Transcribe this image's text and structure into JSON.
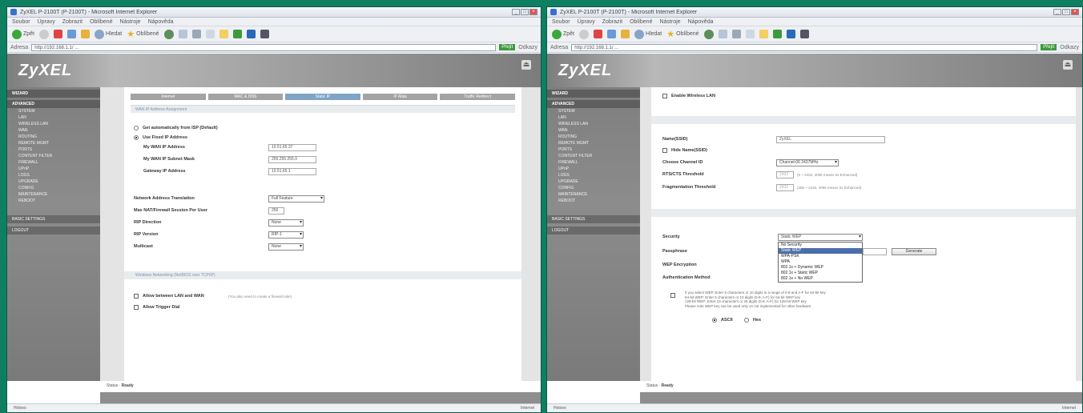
{
  "browser": {
    "title": "ZyXEL P-2100T (P-2100T) - Microsoft Internet Explorer",
    "menu": [
      "Soubor",
      "Úpravy",
      "Zobrazit",
      "Oblíbené",
      "Nástroje",
      "Nápověda"
    ],
    "back_label": "Zpět",
    "search_label": "Hledat",
    "favorites_label": "Oblíbené",
    "address_label": "Adresa",
    "address": "http://192.168.1.1/ ...",
    "go_label": "Přejít",
    "links_label": "Odkazy",
    "status_left": "Hotovo",
    "status_right": "Internet"
  },
  "left": {
    "logo": "ZyXEL",
    "nav_group_1": "WIZARD",
    "nav_group_2": "ADVANCED",
    "nav_items": [
      "SYSTEM",
      "LAN",
      "WIRELESS LAN",
      "WAN",
      "ROUTING",
      "REMOTE MGMT",
      "PORTS",
      "CONTENT FILTER",
      "FIREWALL",
      "UPnP",
      "LOGS",
      "UPGRADE",
      "CONFIG",
      "MAINTENANCE",
      "REBOOT"
    ],
    "nav_sub_1": "BASIC SETTINGS",
    "nav_sub_2": "LOGOUT",
    "tabs": [
      "Internet",
      "MAC & DNS",
      "Static IP",
      "IP Alias",
      "Traffic Redirect"
    ],
    "section_title": "WAN IP Address Assignment",
    "radio_auto": "Get automatically from ISP (Default)",
    "radio_fixed": "Use Fixed IP Address",
    "fields": [
      {
        "label": "My WAN IP Address",
        "value": "10.51.65.37"
      },
      {
        "label": "My WAN IP Subnet Mask",
        "value": "255.255.255.0"
      },
      {
        "label": "Gateway IP Address",
        "value": "10.51.65.1"
      }
    ],
    "nat_label": "Network Address Translation",
    "nat_value": "Full Feature",
    "mss_label": "Max NAT/Firewall Session Per User",
    "mss_value": "256",
    "rip_dir_label": "RIP Direction",
    "rip_dir_value": "None",
    "rip_ver_label": "RIP Version",
    "rip_ver_value": "RIP-1",
    "multicast_label": "Multicast",
    "multicast_value": "None",
    "section2_title": "Windows Networking (NetBIOS over TCP/IP)",
    "cb1": "Allow between LAN and WAN",
    "cb1_note": "(You also need to create a firewall rule!)",
    "cb2": "Allow Trigger Dial",
    "footer_status": "Status",
    "footer_ready": "Ready"
  },
  "right": {
    "logo": "ZyXEL",
    "enable_wlan": "Enable Wireless LAN",
    "ssid_label": "Name(SSID)",
    "ssid_value": "ZyXEL",
    "hide_ssid": "Hide Name(SSID)",
    "channel_label": "Choose Channel ID",
    "channel_value": "Channel-06 2437MHz",
    "rts_label": "RTS/CTS Threshold",
    "rts_value": "2432",
    "rts_note": "(0 ~ 2432, 4096 means 0x Enhanced)",
    "frag_label": "Fragmentation Threshold",
    "frag_value": "2432",
    "frag_note": "(256 ~ 2432, 4096 means 0x Enhanced)",
    "security_label": "Security",
    "security_value": "Static WEP",
    "security_options": [
      "No Security",
      "Static WEP",
      "WPA-PSK",
      "WPA",
      "802.1x + Dynamic WEP",
      "802.1x + Static WEP",
      "802.1x + No WEP"
    ],
    "passphrase_label": "Passphrase",
    "generate_label": "Generate",
    "wep_label": "WEP Encryption",
    "auth_label": "Authentication Method",
    "wiz_notes": [
      "If you select WEP, Enter 5 characters or 10 digits in a range of 0-9 and A-F for 64-bit key",
      "64-bit WEP: Enter 5 characters or 10 digits (0-9, A-F) for 64-bit WEP key",
      "128-bit WEP: Enter 13 characters or 26 digits (0-9, A-F) for 128-bit WEP key",
      "Please note WEP key can be used only on not implemented for other hardware"
    ],
    "ascii_label": "ASCII",
    "hex_label": "Hex",
    "footer_status": "Status",
    "footer_ready": "Ready"
  }
}
